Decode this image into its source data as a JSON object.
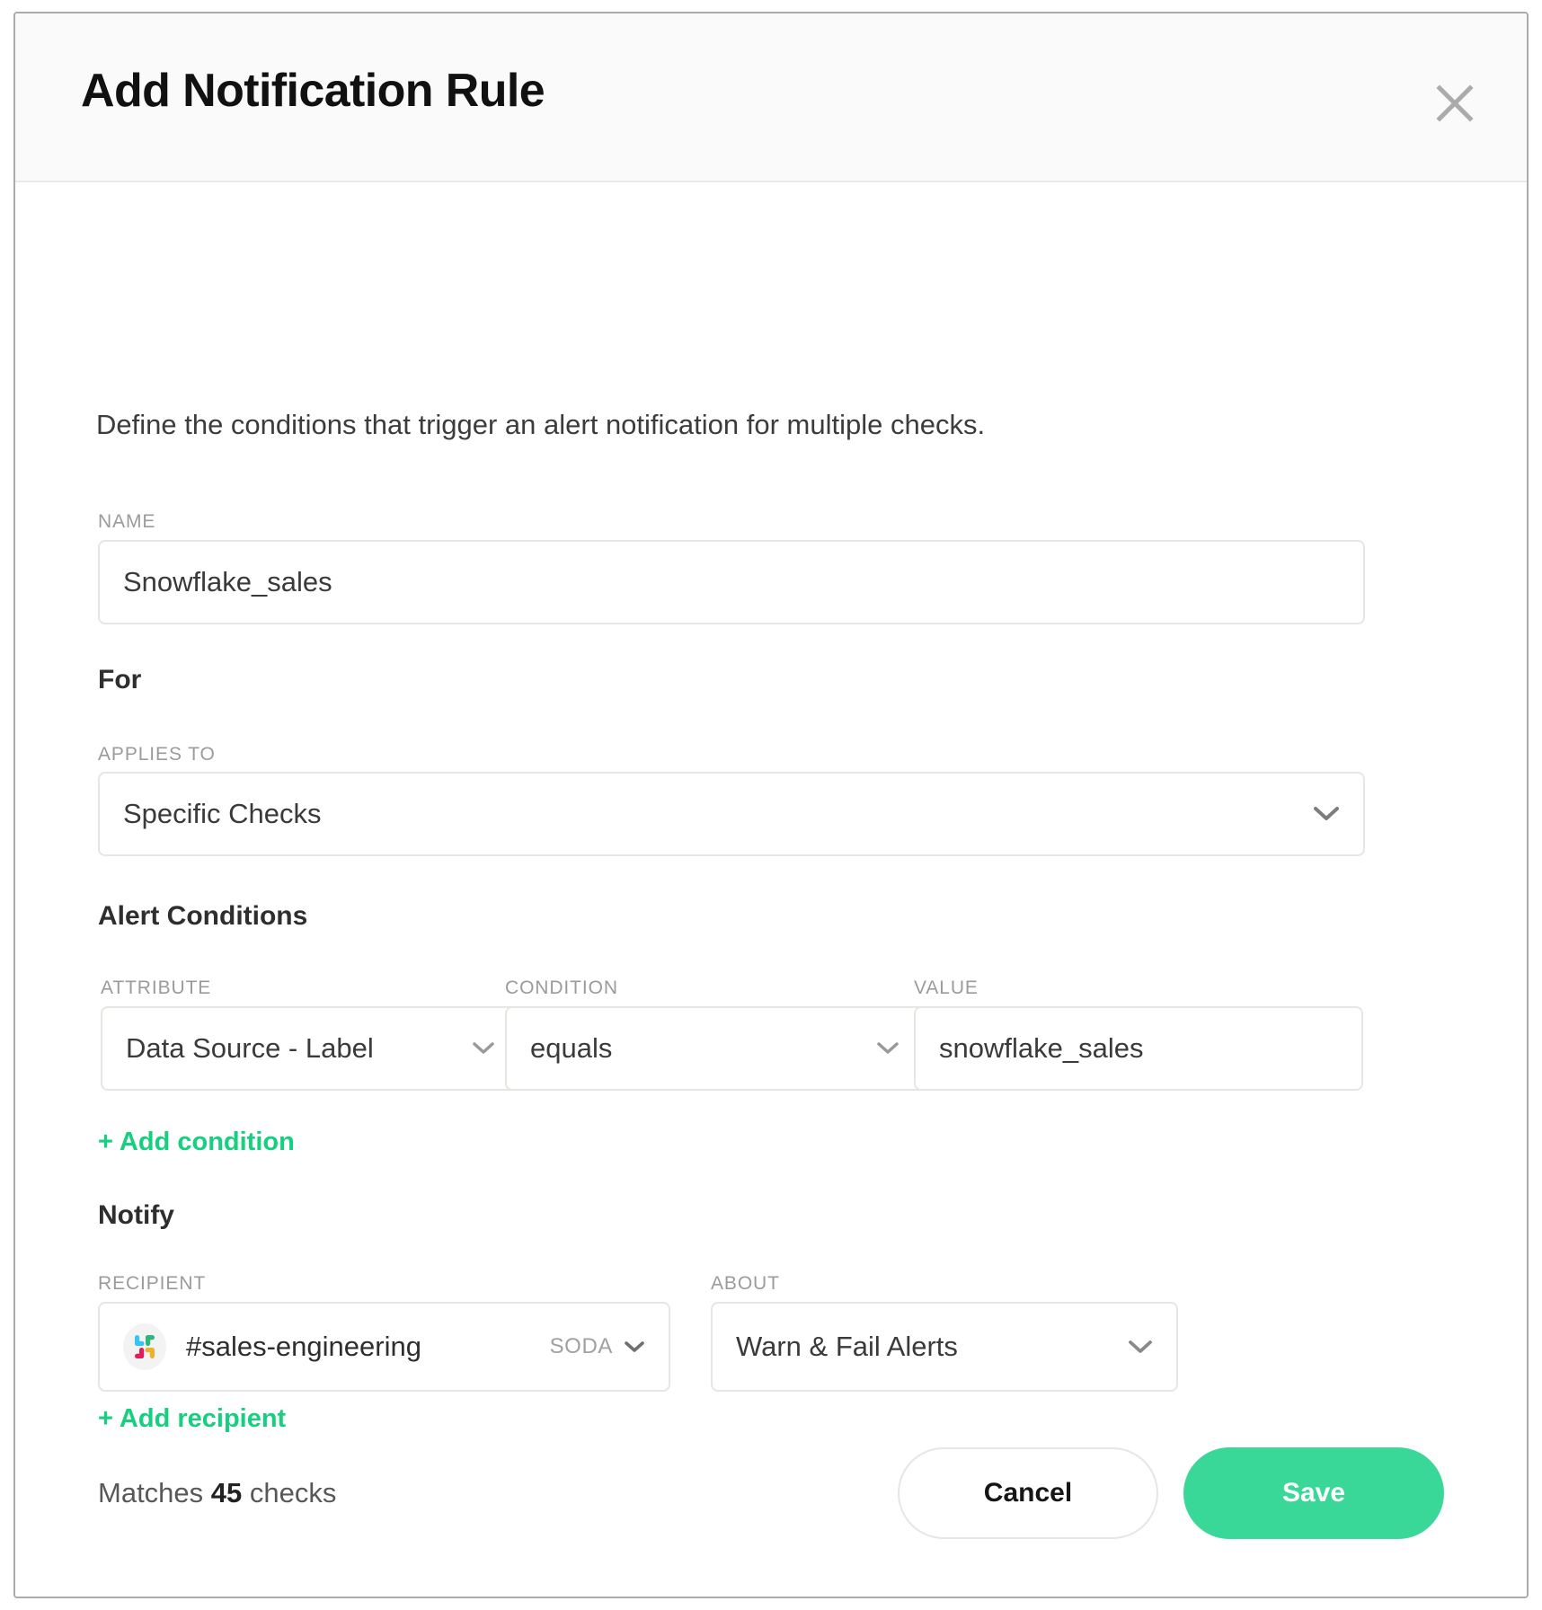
{
  "modal": {
    "title": "Add Notification Rule",
    "close_icon": "close-icon",
    "description": "Define the conditions that trigger an alert notification for multiple checks."
  },
  "name_field": {
    "label": "NAME",
    "value": "Snowflake_sales",
    "placeholder": ""
  },
  "for_section": {
    "heading": "For",
    "applies_to": {
      "label": "APPLIES TO",
      "value": "Specific Checks",
      "chevron_icon": "chevron-down-icon"
    }
  },
  "alert_conditions": {
    "heading": "Alert Conditions",
    "attribute": {
      "label": "ATTRIBUTE",
      "value": "Data Source - Label",
      "chevron_icon": "chevron-down-icon"
    },
    "condition": {
      "label": "CONDITION",
      "value": "equals",
      "chevron_icon": "chevron-down-icon"
    },
    "value": {
      "label": "VALUE",
      "value": "snowflake_sales",
      "placeholder": ""
    },
    "add_condition_label": "+ Add condition"
  },
  "notify": {
    "heading": "Notify",
    "recipient": {
      "label": "RECIPIENT",
      "icon": "slack-icon",
      "value": "#sales-engineering",
      "workspace": "SODA",
      "chevron_icon": "chevron-down-icon"
    },
    "about": {
      "label": "ABOUT",
      "value": "Warn & Fail Alerts",
      "chevron_icon": "chevron-down-icon"
    },
    "add_recipient_label": "+ Add recipient"
  },
  "footer": {
    "matches_prefix": "Matches ",
    "matches_count": "45",
    "matches_suffix": " checks",
    "cancel_label": "Cancel",
    "save_label": "Save"
  },
  "colors": {
    "accent_green": "#17d07f",
    "save_green": "#3ad898",
    "border": "#e6e6e3",
    "label_gray": "#9b9b9b",
    "header_bg": "#fafafa"
  }
}
